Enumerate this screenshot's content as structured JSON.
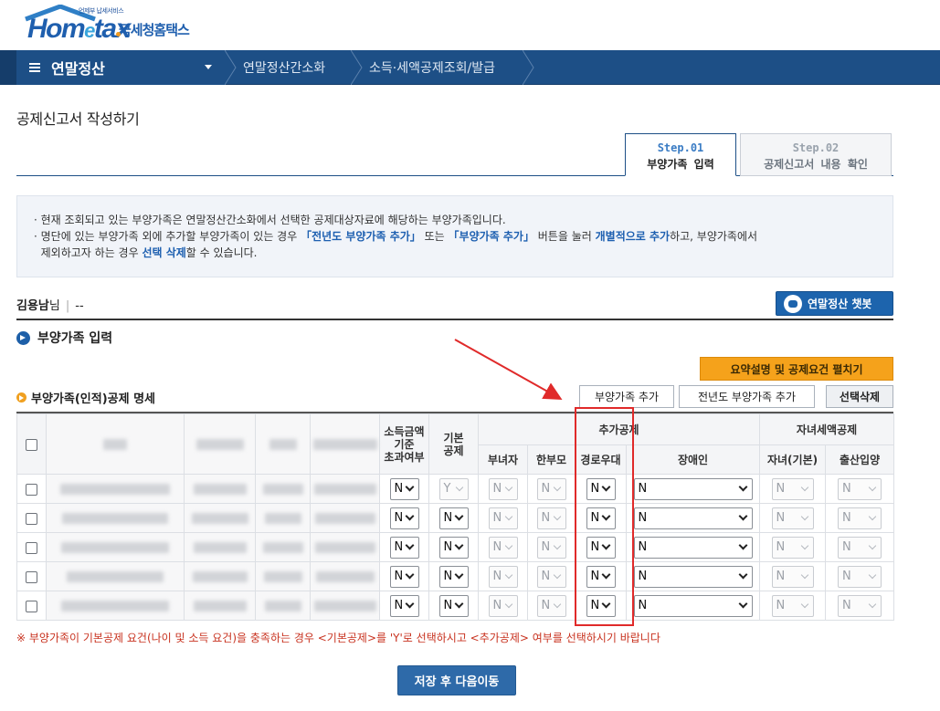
{
  "header": {
    "logo_small": "언제부 납세서비스",
    "logo_word_a": "Hom",
    "logo_word_e": "e",
    "logo_word_b": "tax",
    "logo_korean": "국세청홈택스"
  },
  "nav": {
    "menu_label": "연말정산",
    "crumbs": [
      "연말정산간소화",
      "소득·세액공제조회/발급"
    ]
  },
  "page_title": "공제신고서 작성하기",
  "steps": [
    {
      "num": "Step.01",
      "label": "부양가족 입력",
      "active": true
    },
    {
      "num": "Step.02",
      "label": "공제신고서 내용 확인",
      "active": false
    }
  ],
  "notice": {
    "line1": "현재 조회되고 있는 부양가족은 연말정산간소화에서 선택한 공제대상자료에 해당하는 부양가족입니다.",
    "line2_a": "명단에 있는 부양가족 외에 추가할 부양가족이 있는 경우 ",
    "line2_b": "「전년도 부양가족 추가」",
    "line2_c": " 또는 ",
    "line2_d": "「부양가족 추가」",
    "line2_e": " 버튼을 눌러 ",
    "line2_f": "개별적으로 추가",
    "line2_g": "하고, 부양가족에서",
    "line3_a": "제외하고자 하는 경우 ",
    "line3_b": "선택 삭제",
    "line3_c": "할 수 있습니다."
  },
  "user": {
    "name": "김용남",
    "suffix": "님",
    "sep": "|",
    "extra": "--"
  },
  "chatbot_label": "연말정산 챗봇",
  "section_title": "부양가족 입력",
  "summary_button": "요약설명 및 공제요건 펼치기",
  "table_title": "부양가족(인적)공제 명세",
  "buttons": {
    "add": "부양가족 추가",
    "add_prev": "전년도 부양가족 추가",
    "delete": "선택삭제",
    "save": "저장 후 다음이동"
  },
  "table": {
    "headers": {
      "income_over": [
        "소득금액",
        "기준",
        "초과여부"
      ],
      "basic": [
        "기본",
        "공제"
      ],
      "additional": "추가공제",
      "child_tax": "자녀세액공제",
      "single_female": "부녀자",
      "single_parent": "한부모",
      "elderly": "경로우대",
      "disabled": "장애인",
      "child_basic": "자녀(기본)",
      "birth_adopt": "출산입양"
    },
    "rows": [
      {
        "income_over": "N",
        "basic": "Y",
        "single_female": "N",
        "single_parent": "N",
        "elderly": "N",
        "disabled": "N",
        "child_basic": "N",
        "birth_adopt": "N"
      },
      {
        "income_over": "N",
        "basic": "N",
        "single_female": "N",
        "single_parent": "N",
        "elderly": "N",
        "disabled": "N",
        "child_basic": "N",
        "birth_adopt": "N"
      },
      {
        "income_over": "N",
        "basic": "N",
        "single_female": "N",
        "single_parent": "N",
        "elderly": "N",
        "disabled": "N",
        "child_basic": "N",
        "birth_adopt": "N"
      },
      {
        "income_over": "N",
        "basic": "N",
        "single_female": "N",
        "single_parent": "N",
        "elderly": "N",
        "disabled": "N",
        "child_basic": "N",
        "birth_adopt": "N"
      },
      {
        "income_over": "N",
        "basic": "N",
        "single_female": "N",
        "single_parent": "N",
        "elderly": "N",
        "disabled": "N",
        "child_basic": "N",
        "birth_adopt": "N"
      }
    ]
  },
  "footnote": "※ 부양가족이 기본공제 요건(나이 및 소득 요건)을 충족하는 경우 <기본공제>를 'Y'로 선택하시고 <추가공제> 여부를 선택하시기 바랍니다",
  "colors": {
    "nav": "#1d4f86",
    "accent_blue": "#1d5fb0",
    "orange": "#f5a21b",
    "annotation_red": "#e02a2a"
  }
}
